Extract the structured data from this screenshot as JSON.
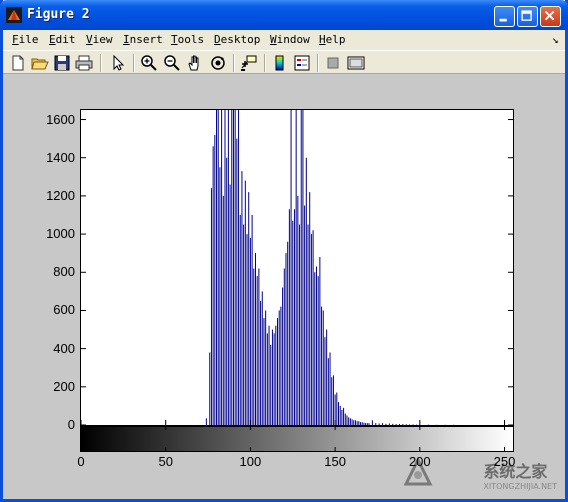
{
  "window": {
    "title": "Figure 2"
  },
  "menu": {
    "items": [
      {
        "key": "F",
        "rest": "ile"
      },
      {
        "key": "E",
        "rest": "dit"
      },
      {
        "key": "V",
        "rest": "iew"
      },
      {
        "key": "I",
        "rest": "nsert"
      },
      {
        "key": "T",
        "rest": "ools"
      },
      {
        "key": "D",
        "rest": "esktop"
      },
      {
        "key": "W",
        "rest": "indow"
      },
      {
        "key": "H",
        "rest": "elp"
      }
    ],
    "dock_glyph": "↘"
  },
  "toolbar": {
    "icons": [
      "new-file-icon",
      "open-file-icon",
      "save-icon",
      "print-icon",
      "select-arrow-icon",
      "zoom-in-icon",
      "zoom-out-icon",
      "pan-hand-icon",
      "rotate-3d-icon",
      "data-cursor-icon",
      "colorbar-icon",
      "legend-icon",
      "hide-plot-tools-icon",
      "show-plot-tools-icon"
    ]
  },
  "watermark": {
    "main": "系统之家",
    "sub": "XITONGZHIJIA.NET"
  },
  "chart_data": {
    "type": "bar",
    "title": "",
    "xlabel": "",
    "ylabel": "",
    "xlim": [
      0,
      255
    ],
    "ylim": [
      0,
      1650
    ],
    "yticks": [
      0,
      200,
      400,
      600,
      800,
      1000,
      1200,
      1400,
      1600
    ],
    "xticks": [
      0,
      50,
      100,
      150,
      200,
      250
    ],
    "bar_color": "#00008b",
    "colorbar": {
      "from": "#000000",
      "to": "#ffffff",
      "range": [
        0,
        255
      ]
    },
    "x": [
      74,
      76,
      77,
      78,
      79,
      80,
      81,
      82,
      83,
      84,
      85,
      86,
      87,
      88,
      89,
      90,
      91,
      92,
      93,
      94,
      95,
      96,
      97,
      98,
      99,
      100,
      101,
      102,
      103,
      104,
      105,
      106,
      107,
      108,
      109,
      110,
      111,
      112,
      113,
      114,
      115,
      116,
      117,
      118,
      119,
      120,
      121,
      122,
      123,
      124,
      125,
      126,
      127,
      128,
      129,
      130,
      131,
      132,
      133,
      134,
      135,
      136,
      137,
      138,
      139,
      140,
      141,
      142,
      143,
      144,
      145,
      146,
      147,
      148,
      149,
      150,
      151,
      152,
      153,
      154,
      155,
      156,
      157,
      158,
      159,
      160,
      161,
      162,
      163,
      164,
      165,
      166,
      167,
      168,
      169,
      170,
      172,
      174,
      176,
      178,
      180,
      182,
      184,
      186,
      188,
      190,
      192,
      194,
      196,
      198,
      200,
      205,
      210,
      215,
      220,
      230
    ],
    "values": [
      35,
      380,
      1240,
      1460,
      1520,
      1650,
      1650,
      1350,
      1650,
      1200,
      1650,
      1400,
      1650,
      1260,
      1650,
      1650,
      1650,
      1500,
      1650,
      1100,
      1330,
      1050,
      1280,
      1000,
      1220,
      980,
      1100,
      820,
      900,
      780,
      820,
      650,
      700,
      560,
      600,
      480,
      520,
      420,
      500,
      480,
      520,
      560,
      600,
      620,
      720,
      820,
      900,
      960,
      1130,
      1650,
      1070,
      1130,
      1650,
      1200,
      1050,
      1650,
      1650,
      1150,
      1400,
      1050,
      1220,
      1000,
      1020,
      800,
      830,
      780,
      880,
      620,
      600,
      460,
      500,
      350,
      380,
      250,
      260,
      160,
      170,
      120,
      100,
      80,
      90,
      60,
      50,
      40,
      35,
      30,
      25,
      25,
      20,
      20,
      15,
      15,
      12,
      10,
      10,
      10,
      25,
      10,
      8,
      10,
      6,
      8,
      6,
      5,
      5,
      5,
      4,
      3,
      3,
      2,
      2,
      2,
      1,
      1,
      1,
      0
    ]
  }
}
